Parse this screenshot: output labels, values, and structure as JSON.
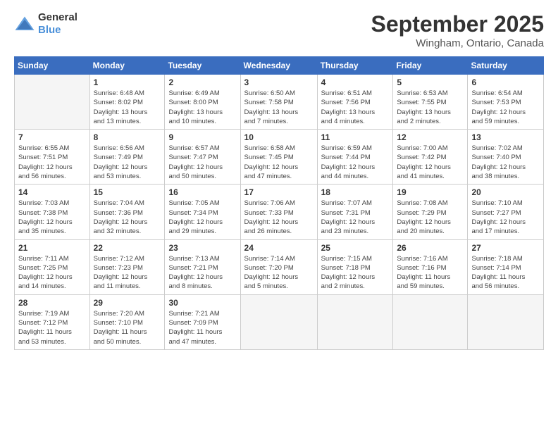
{
  "logo": {
    "general": "General",
    "blue": "Blue"
  },
  "title": "September 2025",
  "location": "Wingham, Ontario, Canada",
  "days_of_week": [
    "Sunday",
    "Monday",
    "Tuesday",
    "Wednesday",
    "Thursday",
    "Friday",
    "Saturday"
  ],
  "weeks": [
    [
      {
        "day": "",
        "info": ""
      },
      {
        "day": "1",
        "info": "Sunrise: 6:48 AM\nSunset: 8:02 PM\nDaylight: 13 hours\nand 13 minutes."
      },
      {
        "day": "2",
        "info": "Sunrise: 6:49 AM\nSunset: 8:00 PM\nDaylight: 13 hours\nand 10 minutes."
      },
      {
        "day": "3",
        "info": "Sunrise: 6:50 AM\nSunset: 7:58 PM\nDaylight: 13 hours\nand 7 minutes."
      },
      {
        "day": "4",
        "info": "Sunrise: 6:51 AM\nSunset: 7:56 PM\nDaylight: 13 hours\nand 4 minutes."
      },
      {
        "day": "5",
        "info": "Sunrise: 6:53 AM\nSunset: 7:55 PM\nDaylight: 13 hours\nand 2 minutes."
      },
      {
        "day": "6",
        "info": "Sunrise: 6:54 AM\nSunset: 7:53 PM\nDaylight: 12 hours\nand 59 minutes."
      }
    ],
    [
      {
        "day": "7",
        "info": "Sunrise: 6:55 AM\nSunset: 7:51 PM\nDaylight: 12 hours\nand 56 minutes."
      },
      {
        "day": "8",
        "info": "Sunrise: 6:56 AM\nSunset: 7:49 PM\nDaylight: 12 hours\nand 53 minutes."
      },
      {
        "day": "9",
        "info": "Sunrise: 6:57 AM\nSunset: 7:47 PM\nDaylight: 12 hours\nand 50 minutes."
      },
      {
        "day": "10",
        "info": "Sunrise: 6:58 AM\nSunset: 7:45 PM\nDaylight: 12 hours\nand 47 minutes."
      },
      {
        "day": "11",
        "info": "Sunrise: 6:59 AM\nSunset: 7:44 PM\nDaylight: 12 hours\nand 44 minutes."
      },
      {
        "day": "12",
        "info": "Sunrise: 7:00 AM\nSunset: 7:42 PM\nDaylight: 12 hours\nand 41 minutes."
      },
      {
        "day": "13",
        "info": "Sunrise: 7:02 AM\nSunset: 7:40 PM\nDaylight: 12 hours\nand 38 minutes."
      }
    ],
    [
      {
        "day": "14",
        "info": "Sunrise: 7:03 AM\nSunset: 7:38 PM\nDaylight: 12 hours\nand 35 minutes."
      },
      {
        "day": "15",
        "info": "Sunrise: 7:04 AM\nSunset: 7:36 PM\nDaylight: 12 hours\nand 32 minutes."
      },
      {
        "day": "16",
        "info": "Sunrise: 7:05 AM\nSunset: 7:34 PM\nDaylight: 12 hours\nand 29 minutes."
      },
      {
        "day": "17",
        "info": "Sunrise: 7:06 AM\nSunset: 7:33 PM\nDaylight: 12 hours\nand 26 minutes."
      },
      {
        "day": "18",
        "info": "Sunrise: 7:07 AM\nSunset: 7:31 PM\nDaylight: 12 hours\nand 23 minutes."
      },
      {
        "day": "19",
        "info": "Sunrise: 7:08 AM\nSunset: 7:29 PM\nDaylight: 12 hours\nand 20 minutes."
      },
      {
        "day": "20",
        "info": "Sunrise: 7:10 AM\nSunset: 7:27 PM\nDaylight: 12 hours\nand 17 minutes."
      }
    ],
    [
      {
        "day": "21",
        "info": "Sunrise: 7:11 AM\nSunset: 7:25 PM\nDaylight: 12 hours\nand 14 minutes."
      },
      {
        "day": "22",
        "info": "Sunrise: 7:12 AM\nSunset: 7:23 PM\nDaylight: 12 hours\nand 11 minutes."
      },
      {
        "day": "23",
        "info": "Sunrise: 7:13 AM\nSunset: 7:21 PM\nDaylight: 12 hours\nand 8 minutes."
      },
      {
        "day": "24",
        "info": "Sunrise: 7:14 AM\nSunset: 7:20 PM\nDaylight: 12 hours\nand 5 minutes."
      },
      {
        "day": "25",
        "info": "Sunrise: 7:15 AM\nSunset: 7:18 PM\nDaylight: 12 hours\nand 2 minutes."
      },
      {
        "day": "26",
        "info": "Sunrise: 7:16 AM\nSunset: 7:16 PM\nDaylight: 11 hours\nand 59 minutes."
      },
      {
        "day": "27",
        "info": "Sunrise: 7:18 AM\nSunset: 7:14 PM\nDaylight: 11 hours\nand 56 minutes."
      }
    ],
    [
      {
        "day": "28",
        "info": "Sunrise: 7:19 AM\nSunset: 7:12 PM\nDaylight: 11 hours\nand 53 minutes."
      },
      {
        "day": "29",
        "info": "Sunrise: 7:20 AM\nSunset: 7:10 PM\nDaylight: 11 hours\nand 50 minutes."
      },
      {
        "day": "30",
        "info": "Sunrise: 7:21 AM\nSunset: 7:09 PM\nDaylight: 11 hours\nand 47 minutes."
      },
      {
        "day": "",
        "info": ""
      },
      {
        "day": "",
        "info": ""
      },
      {
        "day": "",
        "info": ""
      },
      {
        "day": "",
        "info": ""
      }
    ]
  ]
}
